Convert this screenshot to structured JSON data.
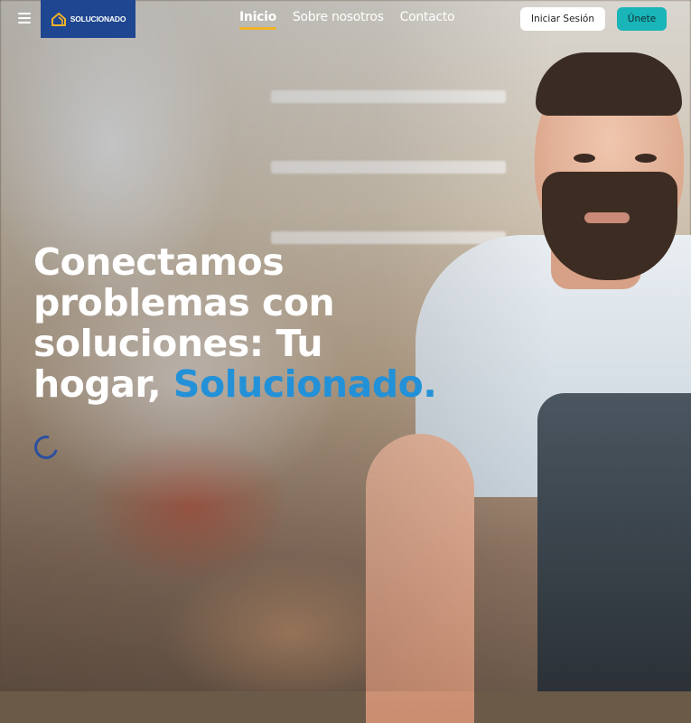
{
  "colors": {
    "brand_navy": "#1f4690",
    "accent_blue": "#2391d8",
    "teal": "#19b5b8",
    "underline_gold": "#f0b429",
    "spinner": "#2b4fa0"
  },
  "header": {
    "menu_icon": "hamburger-icon",
    "logo_icon": "house-icon",
    "logo_text": "SOLUCIONADO",
    "nav": [
      {
        "label": "Inicio",
        "active": true
      },
      {
        "label": "Sobre nosotros",
        "active": false
      },
      {
        "label": "Contacto",
        "active": false
      }
    ],
    "login_label": "Iniciar Sesión",
    "join_label": "Únete"
  },
  "hero": {
    "title_lines": [
      "Conectamos",
      "problemas con",
      "soluciones: Tu"
    ],
    "title_last_prefix": "hogar,",
    "title_accent": "Solucionado.",
    "loading_icon": "spinner-icon"
  }
}
